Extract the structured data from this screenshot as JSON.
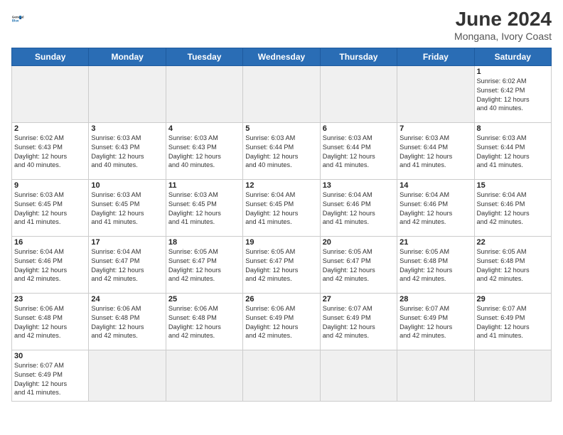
{
  "header": {
    "logo_general": "General",
    "logo_blue": "Blue",
    "title": "June 2024",
    "subtitle": "Mongana, Ivory Coast"
  },
  "days_of_week": [
    "Sunday",
    "Monday",
    "Tuesday",
    "Wednesday",
    "Thursday",
    "Friday",
    "Saturday"
  ],
  "weeks": [
    [
      {
        "day": "",
        "empty": true
      },
      {
        "day": "",
        "empty": true
      },
      {
        "day": "",
        "empty": true
      },
      {
        "day": "",
        "empty": true
      },
      {
        "day": "",
        "empty": true
      },
      {
        "day": "",
        "empty": true
      },
      {
        "day": "1",
        "rise": "6:02 AM",
        "set": "6:42 PM",
        "hours": "12 hours",
        "mins": "and 40 minutes."
      }
    ],
    [
      {
        "day": "2",
        "rise": "6:02 AM",
        "set": "6:43 PM",
        "hours": "12 hours",
        "mins": "and 40 minutes."
      },
      {
        "day": "3",
        "rise": "6:03 AM",
        "set": "6:43 PM",
        "hours": "12 hours",
        "mins": "and 40 minutes."
      },
      {
        "day": "4",
        "rise": "6:03 AM",
        "set": "6:43 PM",
        "hours": "12 hours",
        "mins": "and 40 minutes."
      },
      {
        "day": "5",
        "rise": "6:03 AM",
        "set": "6:44 PM",
        "hours": "12 hours",
        "mins": "and 40 minutes."
      },
      {
        "day": "6",
        "rise": "6:03 AM",
        "set": "6:44 PM",
        "hours": "12 hours",
        "mins": "and 41 minutes."
      },
      {
        "day": "7",
        "rise": "6:03 AM",
        "set": "6:44 PM",
        "hours": "12 hours",
        "mins": "and 41 minutes."
      },
      {
        "day": "8",
        "rise": "6:03 AM",
        "set": "6:44 PM",
        "hours": "12 hours",
        "mins": "and 41 minutes."
      }
    ],
    [
      {
        "day": "9",
        "rise": "6:03 AM",
        "set": "6:45 PM",
        "hours": "12 hours",
        "mins": "and 41 minutes."
      },
      {
        "day": "10",
        "rise": "6:03 AM",
        "set": "6:45 PM",
        "hours": "12 hours",
        "mins": "and 41 minutes."
      },
      {
        "day": "11",
        "rise": "6:03 AM",
        "set": "6:45 PM",
        "hours": "12 hours",
        "mins": "and 41 minutes."
      },
      {
        "day": "12",
        "rise": "6:04 AM",
        "set": "6:45 PM",
        "hours": "12 hours",
        "mins": "and 41 minutes."
      },
      {
        "day": "13",
        "rise": "6:04 AM",
        "set": "6:46 PM",
        "hours": "12 hours",
        "mins": "and 41 minutes."
      },
      {
        "day": "14",
        "rise": "6:04 AM",
        "set": "6:46 PM",
        "hours": "12 hours",
        "mins": "and 42 minutes."
      },
      {
        "day": "15",
        "rise": "6:04 AM",
        "set": "6:46 PM",
        "hours": "12 hours",
        "mins": "and 42 minutes."
      }
    ],
    [
      {
        "day": "16",
        "rise": "6:04 AM",
        "set": "6:46 PM",
        "hours": "12 hours",
        "mins": "and 42 minutes."
      },
      {
        "day": "17",
        "rise": "6:04 AM",
        "set": "6:47 PM",
        "hours": "12 hours",
        "mins": "and 42 minutes."
      },
      {
        "day": "18",
        "rise": "6:05 AM",
        "set": "6:47 PM",
        "hours": "12 hours",
        "mins": "and 42 minutes."
      },
      {
        "day": "19",
        "rise": "6:05 AM",
        "set": "6:47 PM",
        "hours": "12 hours",
        "mins": "and 42 minutes."
      },
      {
        "day": "20",
        "rise": "6:05 AM",
        "set": "6:47 PM",
        "hours": "12 hours",
        "mins": "and 42 minutes."
      },
      {
        "day": "21",
        "rise": "6:05 AM",
        "set": "6:48 PM",
        "hours": "12 hours",
        "mins": "and 42 minutes."
      },
      {
        "day": "22",
        "rise": "6:05 AM",
        "set": "6:48 PM",
        "hours": "12 hours",
        "mins": "and 42 minutes."
      }
    ],
    [
      {
        "day": "23",
        "rise": "6:06 AM",
        "set": "6:48 PM",
        "hours": "12 hours",
        "mins": "and 42 minutes."
      },
      {
        "day": "24",
        "rise": "6:06 AM",
        "set": "6:48 PM",
        "hours": "12 hours",
        "mins": "and 42 minutes."
      },
      {
        "day": "25",
        "rise": "6:06 AM",
        "set": "6:48 PM",
        "hours": "12 hours",
        "mins": "and 42 minutes."
      },
      {
        "day": "26",
        "rise": "6:06 AM",
        "set": "6:49 PM",
        "hours": "12 hours",
        "mins": "and 42 minutes."
      },
      {
        "day": "27",
        "rise": "6:07 AM",
        "set": "6:49 PM",
        "hours": "12 hours",
        "mins": "and 42 minutes."
      },
      {
        "day": "28",
        "rise": "6:07 AM",
        "set": "6:49 PM",
        "hours": "12 hours",
        "mins": "and 42 minutes."
      },
      {
        "day": "29",
        "rise": "6:07 AM",
        "set": "6:49 PM",
        "hours": "12 hours",
        "mins": "and 41 minutes."
      }
    ],
    [
      {
        "day": "30",
        "rise": "6:07 AM",
        "set": "6:49 PM",
        "hours": "12 hours",
        "mins": "and 41 minutes."
      },
      {
        "day": "",
        "empty": true
      },
      {
        "day": "",
        "empty": true
      },
      {
        "day": "",
        "empty": true
      },
      {
        "day": "",
        "empty": true
      },
      {
        "day": "",
        "empty": true
      },
      {
        "day": "",
        "empty": true
      }
    ]
  ]
}
